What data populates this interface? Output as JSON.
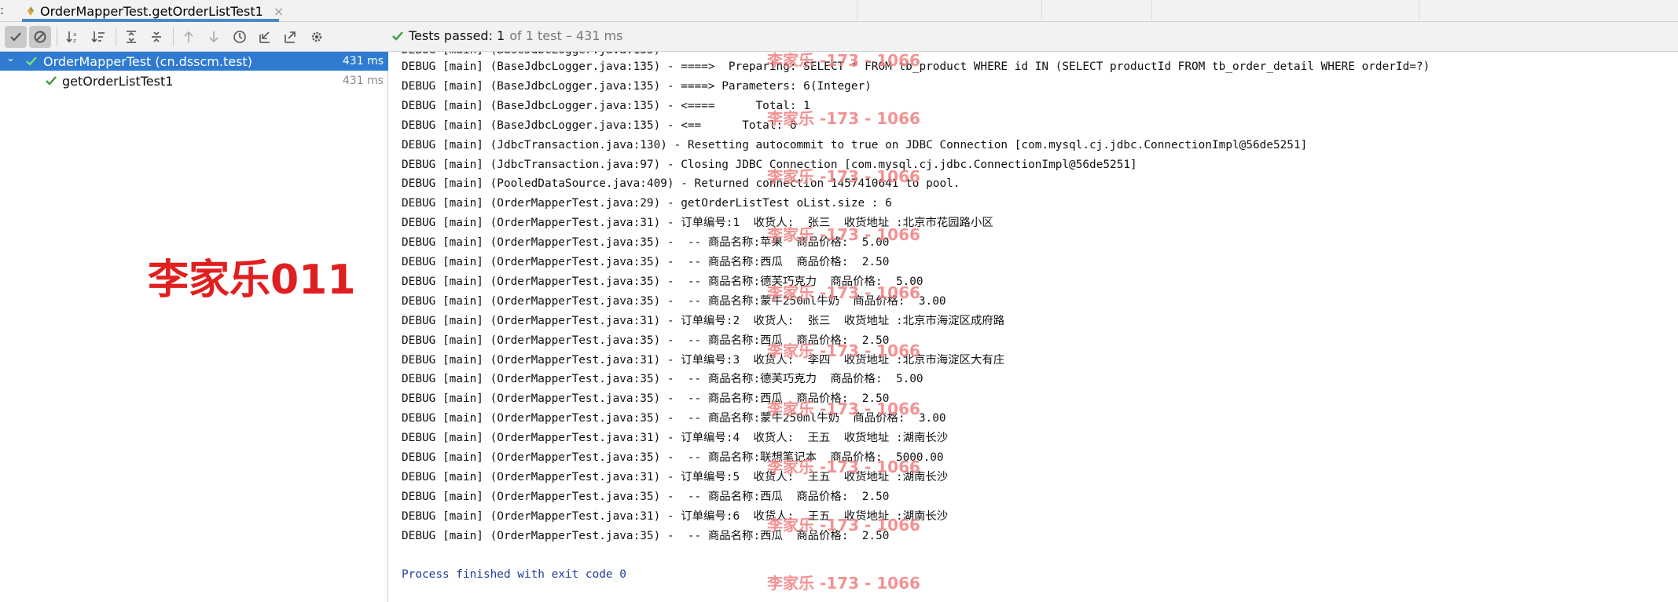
{
  "tab": {
    "title": "OrderMapperTest.getOrderListTest1",
    "close": "×",
    "colon": ":"
  },
  "status": {
    "icon": "check-icon",
    "passed_label": "Tests passed:",
    "passed_count": "1",
    "detail": "of 1 test – 431 ms"
  },
  "toolbar_icons": [
    "show-passed-icon",
    "show-ignored-icon",
    "sort-alpha-icon",
    "sort-duration-icon",
    "expand-all-icon",
    "collapse-all-icon",
    "prev-failed-icon",
    "next-failed-icon",
    "history-icon",
    "import-tests-icon",
    "export-icon",
    "settings-icon"
  ],
  "tree": {
    "suite": {
      "label": "OrderMapperTest (cn.dsscm.test)",
      "time": "431 ms"
    },
    "test": {
      "label": "getOrderListTest1",
      "time": "431 ms"
    }
  },
  "watermark_big": "李家乐011",
  "watermark_small": "李家乐 -173 - 1066",
  "console": {
    "lines": [
      "DEBUG [main] (BaseJdbcLogger.java:135) - ====>  Preparing: SELECT * FROM tb_product WHERE id IN (SELECT productId FROM tb_order_detail WHERE orderId=?)",
      "DEBUG [main] (BaseJdbcLogger.java:135) - ====> Parameters: 6(Integer)",
      "DEBUG [main] (BaseJdbcLogger.java:135) - <====      Total: 1",
      "DEBUG [main] (BaseJdbcLogger.java:135) - <==      Total: 6",
      "DEBUG [main] (JdbcTransaction.java:130) - Resetting autocommit to true on JDBC Connection [com.mysql.cj.jdbc.ConnectionImpl@56de5251]",
      "DEBUG [main] (JdbcTransaction.java:97) - Closing JDBC Connection [com.mysql.cj.jdbc.ConnectionImpl@56de5251]",
      "DEBUG [main] (PooledDataSource.java:409) - Returned connection 1457410641 to pool.",
      "DEBUG [main] (OrderMapperTest.java:29) - getOrderListTest oList.size : 6",
      "DEBUG [main] (OrderMapperTest.java:31) - 订单编号:1  收货人:  张三  收货地址 :北京市花园路小区",
      "DEBUG [main] (OrderMapperTest.java:35) -  -- 商品名称:苹果  商品价格:  5.00",
      "DEBUG [main] (OrderMapperTest.java:35) -  -- 商品名称:西瓜  商品价格:  2.50",
      "DEBUG [main] (OrderMapperTest.java:35) -  -- 商品名称:德芙巧克力  商品价格:  5.00",
      "DEBUG [main] (OrderMapperTest.java:35) -  -- 商品名称:蒙牛250ml牛奶  商品价格:  3.00",
      "DEBUG [main] (OrderMapperTest.java:31) - 订单编号:2  收货人:  张三  收货地址 :北京市海淀区成府路",
      "DEBUG [main] (OrderMapperTest.java:35) -  -- 商品名称:西瓜  商品价格:  2.50",
      "DEBUG [main] (OrderMapperTest.java:31) - 订单编号:3  收货人:  李四  收货地址 :北京市海淀区大有庄",
      "DEBUG [main] (OrderMapperTest.java:35) -  -- 商品名称:德芙巧克力  商品价格:  5.00",
      "DEBUG [main] (OrderMapperTest.java:35) -  -- 商品名称:西瓜  商品价格:  2.50",
      "DEBUG [main] (OrderMapperTest.java:35) -  -- 商品名称:蒙牛250ml牛奶  商品价格:  3.00",
      "DEBUG [main] (OrderMapperTest.java:31) - 订单编号:4  收货人:  王五  收货地址 :湖南长沙",
      "DEBUG [main] (OrderMapperTest.java:35) -  -- 商品名称:联想笔记本  商品价格:  5000.00",
      "DEBUG [main] (OrderMapperTest.java:31) - 订单编号:5  收货人:  王五  收货地址 :湖南长沙",
      "DEBUG [main] (OrderMapperTest.java:35) -  -- 商品名称:西瓜  商品价格:  2.50",
      "DEBUG [main] (OrderMapperTest.java:31) - 订单编号:6  收货人:  王五  收货地址 :湖南长沙",
      "DEBUG [main] (OrderMapperTest.java:35) -  -- 商品名称:西瓜  商品价格:  2.50"
    ],
    "finish": "Process finished with exit code 0"
  }
}
